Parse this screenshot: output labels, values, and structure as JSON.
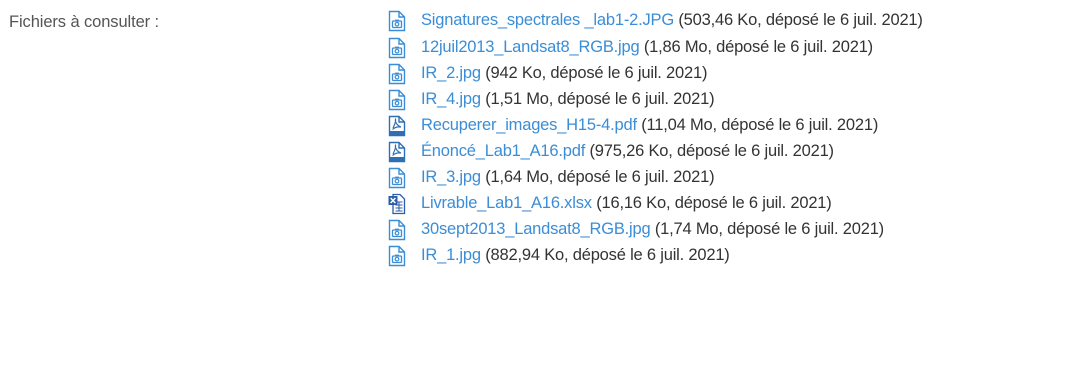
{
  "label": "Fichiers à consulter :",
  "files": [
    {
      "name": "Signatures_spectrales _lab1-2.JPG",
      "meta": "(503,46 Ko, déposé le 6 juil. 2021)",
      "icon": "image-file-icon"
    },
    {
      "name": "12juil2013_Landsat8_RGB.jpg",
      "meta": "(1,86 Mo, déposé le 6 juil. 2021)",
      "icon": "image-file-icon"
    },
    {
      "name": "IR_2.jpg",
      "meta": "(942 Ko, déposé le 6 juil. 2021)",
      "icon": "image-file-icon"
    },
    {
      "name": "IR_4.jpg",
      "meta": "(1,51 Mo, déposé le 6 juil. 2021)",
      "icon": "image-file-icon"
    },
    {
      "name": "Recuperer_images_H15-4.pdf",
      "meta": "(11,04 Mo, déposé le 6 juil. 2021)",
      "icon": "pdf-file-icon"
    },
    {
      "name": "Énoncé_Lab1_A16.pdf",
      "meta": "(975,26 Ko, déposé le 6 juil. 2021)",
      "icon": "pdf-file-icon"
    },
    {
      "name": "IR_3.jpg",
      "meta": "(1,64 Mo, déposé le 6 juil. 2021)",
      "icon": "image-file-icon"
    },
    {
      "name": "Livrable_Lab1_A16.xlsx",
      "meta": "(16,16 Ko, déposé le 6 juil. 2021)",
      "icon": "excel-file-icon"
    },
    {
      "name": "30sept2013_Landsat8_RGB.jpg",
      "meta": "(1,74 Mo, déposé le 6 juil. 2021)",
      "icon": "image-file-icon"
    },
    {
      "name": "IR_1.jpg",
      "meta": "(882,94 Ko, déposé le 6 juil. 2021)",
      "icon": "image-file-icon"
    }
  ],
  "colors": {
    "link": "#3a8dd6",
    "text": "#333333",
    "label": "#555555",
    "pdf_icon": "#2f6fb3",
    "excel_icon": "#2a5fa8"
  }
}
